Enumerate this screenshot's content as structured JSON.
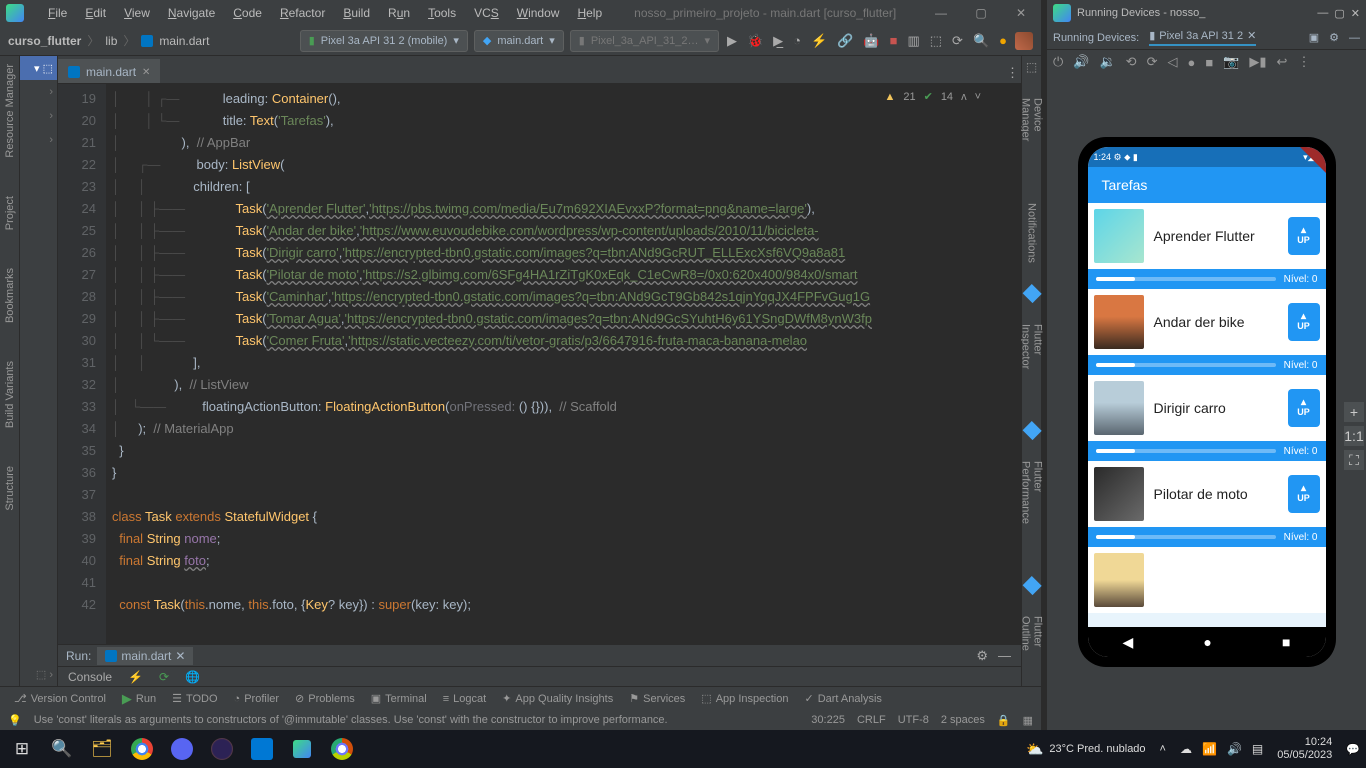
{
  "window_title": "nosso_primeiro_projeto - main.dart [curso_flutter]",
  "menu": [
    "File",
    "Edit",
    "View",
    "Navigate",
    "Code",
    "Refactor",
    "Build",
    "Run",
    "Tools",
    "VCS",
    "Window",
    "Help"
  ],
  "breadcrumb": {
    "root": "curso_flutter",
    "folder": "lib",
    "file": "main.dart"
  },
  "device_selector": "Pixel 3a API 31 2 (mobile)",
  "run_config": "main.dart",
  "emulator_selector": "Pixel_3a_API_31_2…",
  "open_tab": "main.dart",
  "warnings": "21",
  "hints": "14",
  "gutter": [
    "19",
    "20",
    "21",
    "22",
    "23",
    "24",
    "25",
    "26",
    "27",
    "28",
    "29",
    "30",
    "31",
    "32",
    "33",
    "34",
    "35",
    "36",
    "37",
    "38",
    "39",
    "40",
    "41",
    "42"
  ],
  "code": {
    "l19": {
      "a": "            leading: ",
      "b": "Container",
      "c": "(),"
    },
    "l20": {
      "a": "            title: ",
      "b": "Text",
      "c": "(",
      "d": "'Tarefas'",
      "e": "),"
    },
    "l21": {
      "a": "          ),  ",
      "b": "// AppBar"
    },
    "l22": {
      "a": "          body: ",
      "b": "ListView",
      "c": "("
    },
    "l23": "            children: [",
    "l24": {
      "a": "              ",
      "b": "Task",
      "c": "(",
      "d": "'Aprender Flutter'",
      "e": ",",
      "f": "'https://pbs.twimg.com/media/Eu7m692XIAEvxxP?format=png&name=large'",
      "g": "),"
    },
    "l25": {
      "a": "              ",
      "b": "Task",
      "c": "(",
      "d": "'Andar der bike'",
      "e": ",",
      "f": "'https://www.euvoudebike.com/wordpress/wp-content/uploads/2010/11/bicicleta-"
    },
    "l26": {
      "a": "              ",
      "b": "Task",
      "c": "(",
      "d": "'Dirigir carro'",
      "e": ",",
      "f": "'https://encrypted-tbn0.gstatic.com/images?q=tbn:ANd9GcRUT_ELLExcXsf6VQ9a8a81"
    },
    "l27": {
      "a": "              ",
      "b": "Task",
      "c": "(",
      "d": "'Pilotar de moto'",
      "e": ",",
      "f": "'https://s2.glbimg.com/6SFg4HA1rZiTgK0xEqk_C1eCwR8=/0x0:620x400/984x0/smart"
    },
    "l28": {
      "a": "              ",
      "b": "Task",
      "c": "(",
      "d": "'Caminhar'",
      "e": ",",
      "f": "'https://encrypted-tbn0.gstatic.com/images?q=tbn:ANd9GcT9Gb842s1qjnYqqJX4FPFvGug1G"
    },
    "l29": {
      "a": "              ",
      "b": "Task",
      "c": "(",
      "d": "'Tomar Agua'",
      "e": ",",
      "f": "'https://encrypted-tbn0.gstatic.com/images?q=tbn:ANd9GcSYuhtH6y61YSngDWfM8ynW3fp"
    },
    "l30": {
      "a": "              ",
      "b": "Task",
      "c": "(",
      "d": "'Comer Fruta'",
      "e": ",",
      "f": "'https://static.vecteezy.com/ti/vetor-gratis/p3/6647916-fruta-maca-banana-melao"
    },
    "l31": "            ],",
    "l32": {
      "a": "          ),  ",
      "b": "// ListView"
    },
    "l33": {
      "a": "          floatingActionButton: ",
      "b": "FloatingActionButton",
      "c": "(",
      "d": "onPressed:",
      "e": " () {})),  ",
      "f": "// Scaffold"
    },
    "l34": {
      "a": "    );  ",
      "b": "// MaterialApp"
    },
    "l35": "  }",
    "l36": "}",
    "l37": "",
    "l38": {
      "a": "class ",
      "b": "Task ",
      "c": "extends ",
      "d": "StatefulWidget ",
      "e": "{"
    },
    "l39": {
      "a": "  final ",
      "b": "String ",
      "c": "nome",
      "d": ";"
    },
    "l40": {
      "a": "  final ",
      "b": "String ",
      "c": "foto",
      "d": ";"
    },
    "l41": "",
    "l42": {
      "a": "  const ",
      "b": "Task",
      "c": "(",
      "d": "this",
      "e": ".nome, ",
      "f": "this",
      "g": ".foto, {",
      "h": "Key",
      "i": "? key}) : ",
      "j": "super",
      "k": "(key: key);"
    }
  },
  "run_label": "Run:",
  "run_tab_label": "main.dart",
  "console_label": "Console",
  "bottom_tabs": [
    "Version Control",
    "Run",
    "TODO",
    "Profiler",
    "Problems",
    "Terminal",
    "Logcat",
    "App Quality Insights",
    "Services",
    "App Inspection",
    "Dart Analysis"
  ],
  "hint": "Use 'const' literals as arguments to constructors of '@immutable' classes. Use 'const' with the constructor to improve performance.",
  "status": {
    "pos": "30:225",
    "sep": "CRLF",
    "enc": "UTF-8",
    "indent": "2 spaces"
  },
  "dev_title": "Running Devices - nosso_",
  "dev_head": "Running Devices:",
  "dev_tab": "Pixel 3a API 31 2",
  "emulator": {
    "time": "1:24",
    "status_icons": "⚙ ⬥ ▮",
    "signal": "▾◢▮",
    "appbar": "Tarefas",
    "tasks": [
      {
        "name": "Aprender Flutter",
        "cls": "t1"
      },
      {
        "name": "Andar der bike",
        "cls": "t2"
      },
      {
        "name": "Dirigir carro",
        "cls": "t3"
      },
      {
        "name": "Pilotar de moto",
        "cls": "t4"
      }
    ],
    "up": "UP",
    "nivel": "Nível: 0"
  },
  "weather": {
    "temp": "23°C",
    "desc": "Pred. nublado"
  },
  "clock": {
    "t": "10:24",
    "d": "05/05/2023"
  }
}
